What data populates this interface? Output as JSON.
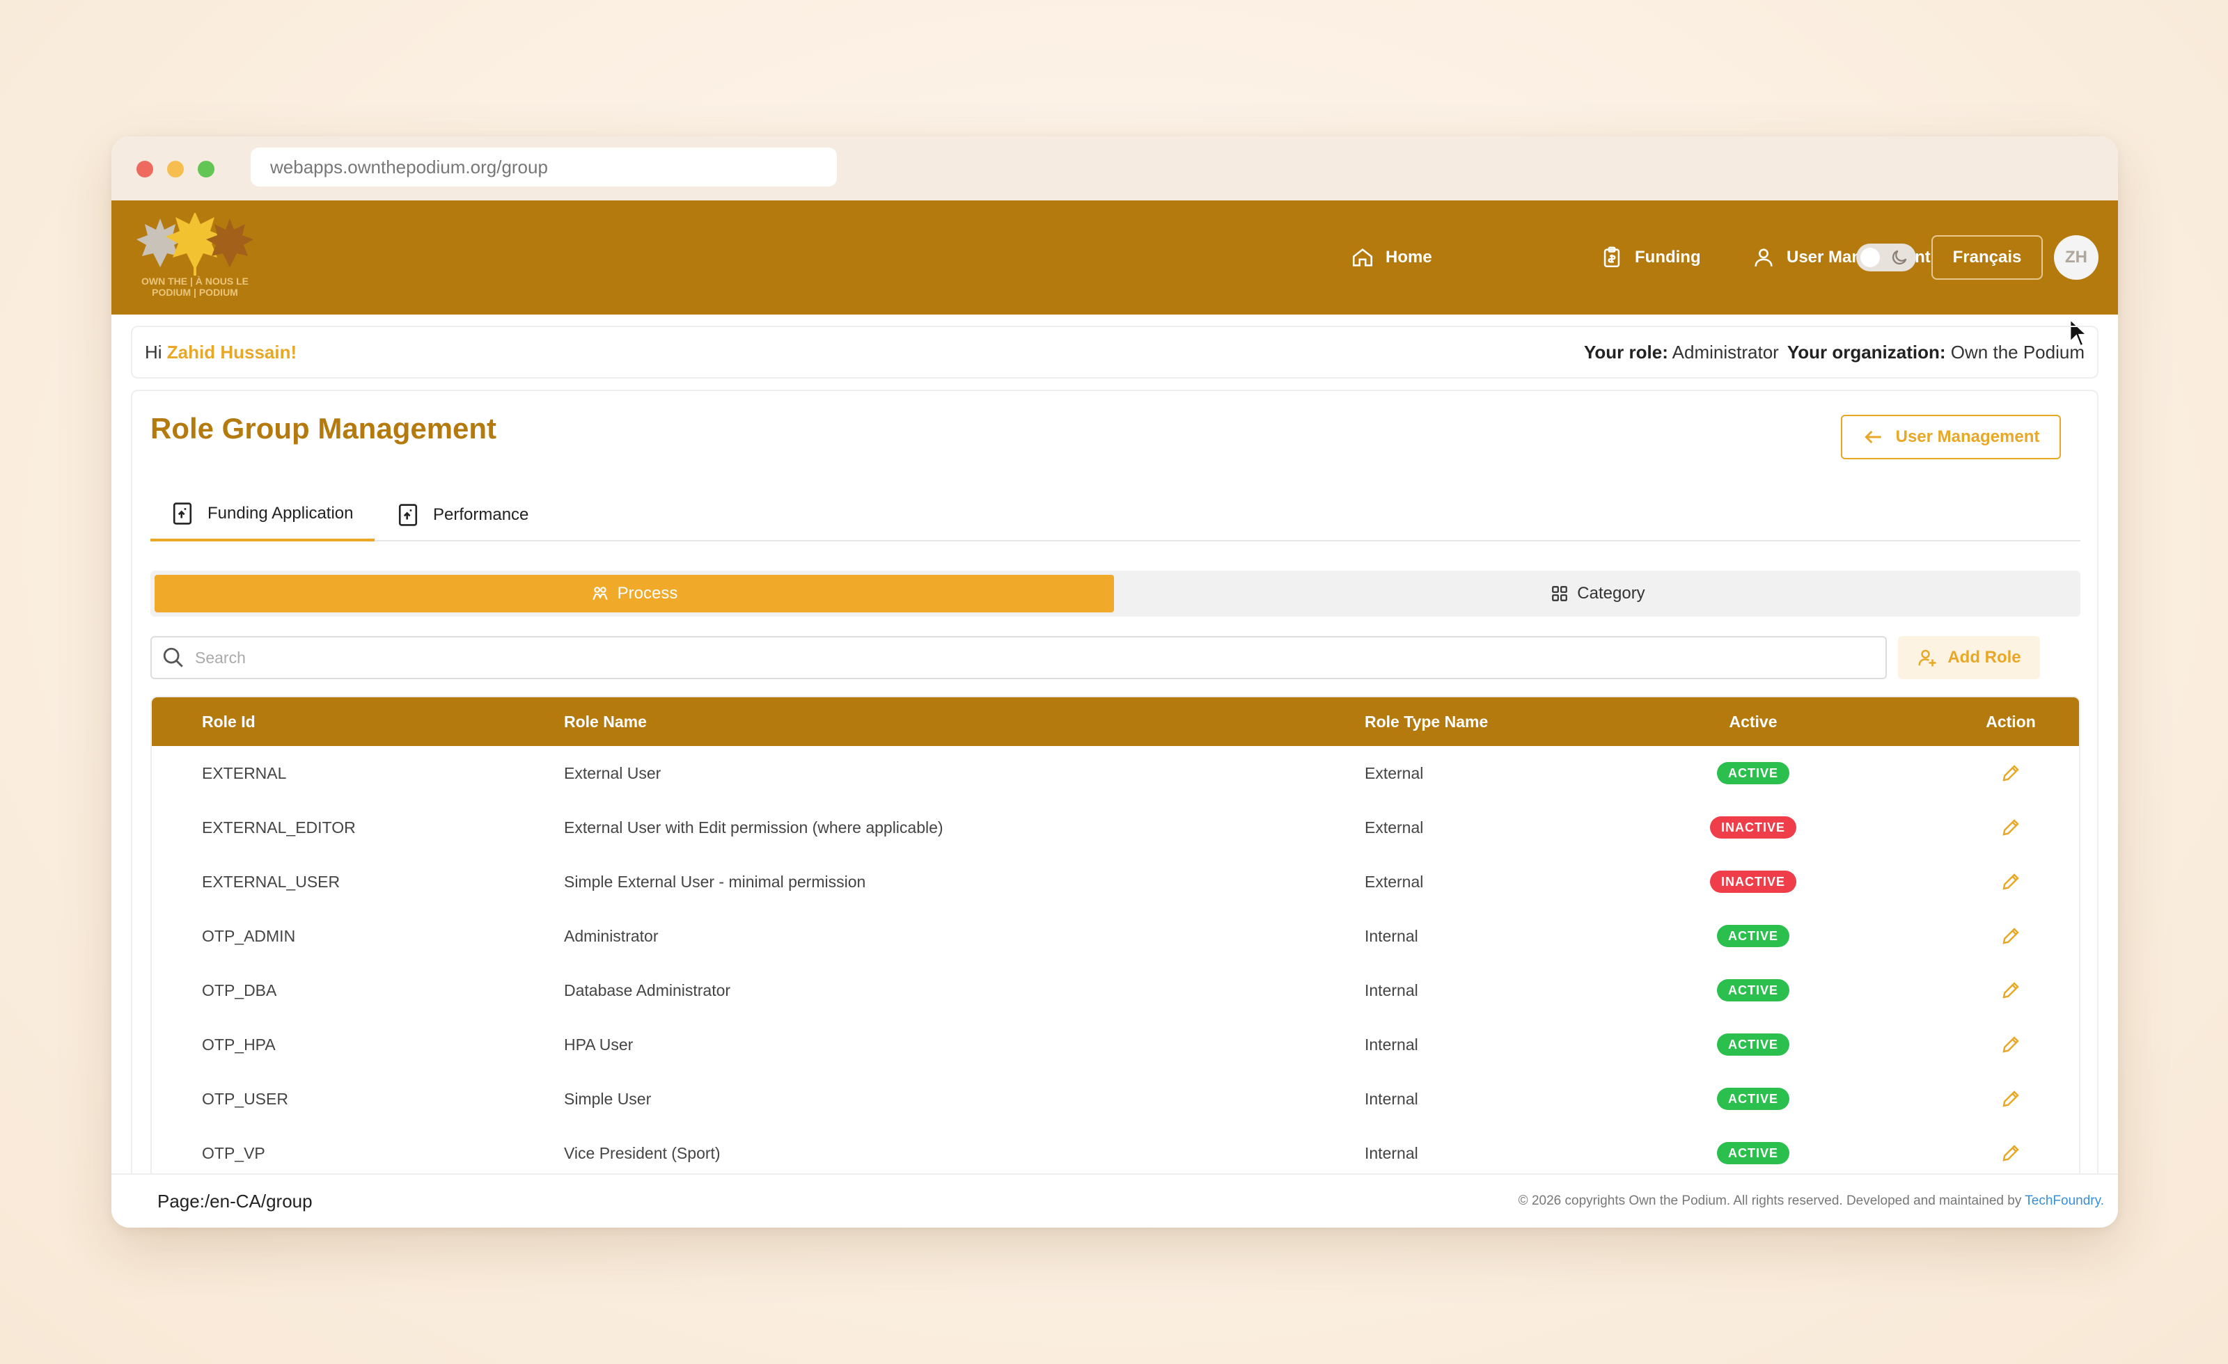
{
  "browser": {
    "url": "webapps.ownthepodium.org/group"
  },
  "header": {
    "logo_lines": [
      "OWN THE | À NOUS LE",
      "PODIUM | PODIUM"
    ],
    "nav": [
      {
        "label": "Home",
        "icon": "home-icon"
      },
      {
        "label": "Funding",
        "icon": "clipboard-icon"
      },
      {
        "label": "User Management",
        "icon": "user-icon"
      }
    ],
    "language_label": "Français",
    "avatar_initials": "ZH"
  },
  "greeting": {
    "prefix": "Hi ",
    "name": "Zahid Hussain!",
    "role_label": "Your role:",
    "role_value": "Administrator",
    "org_label": "Your organization:",
    "org_value": "Own the Podium"
  },
  "page": {
    "title": "Role Group Management",
    "back_button": "User Management",
    "tabs": [
      {
        "label": "Funding Application",
        "active": true
      },
      {
        "label": "Performance",
        "active": false
      }
    ],
    "segments": [
      {
        "label": "Process",
        "active": true
      },
      {
        "label": "Category",
        "active": false
      }
    ],
    "search_placeholder": "Search",
    "add_role_label": "Add Role"
  },
  "table": {
    "columns": [
      "Role Id",
      "Role Name",
      "Role Type Name",
      "Active",
      "Action"
    ],
    "rows": [
      {
        "id": "EXTERNAL",
        "name": "External User",
        "type": "External",
        "status": "ACTIVE"
      },
      {
        "id": "EXTERNAL_EDITOR",
        "name": "External User with Edit permission (where applicable)",
        "type": "External",
        "status": "INACTIVE"
      },
      {
        "id": "EXTERNAL_USER",
        "name": "Simple External User - minimal permission",
        "type": "External",
        "status": "INACTIVE"
      },
      {
        "id": "OTP_ADMIN",
        "name": "Administrator",
        "type": "Internal",
        "status": "ACTIVE"
      },
      {
        "id": "OTP_DBA",
        "name": "Database Administrator",
        "type": "Internal",
        "status": "ACTIVE"
      },
      {
        "id": "OTP_HPA",
        "name": "HPA User",
        "type": "Internal",
        "status": "ACTIVE"
      },
      {
        "id": "OTP_USER",
        "name": "Simple User",
        "type": "Internal",
        "status": "ACTIVE"
      },
      {
        "id": "OTP_VP",
        "name": "Vice President (Sport)",
        "type": "Internal",
        "status": "ACTIVE"
      }
    ]
  },
  "footer": {
    "page_path": "Page:/en-CA/group",
    "copyright": "© 2026 copyrights Own the Podium. All rights reserved. Developed and maintained by ",
    "developer_link": "TechFoundry."
  },
  "colors": {
    "brand": "#b57a0e",
    "accent": "#e8a825",
    "active_badge": "#2bbf4e",
    "inactive_badge": "#ef3d4a"
  }
}
